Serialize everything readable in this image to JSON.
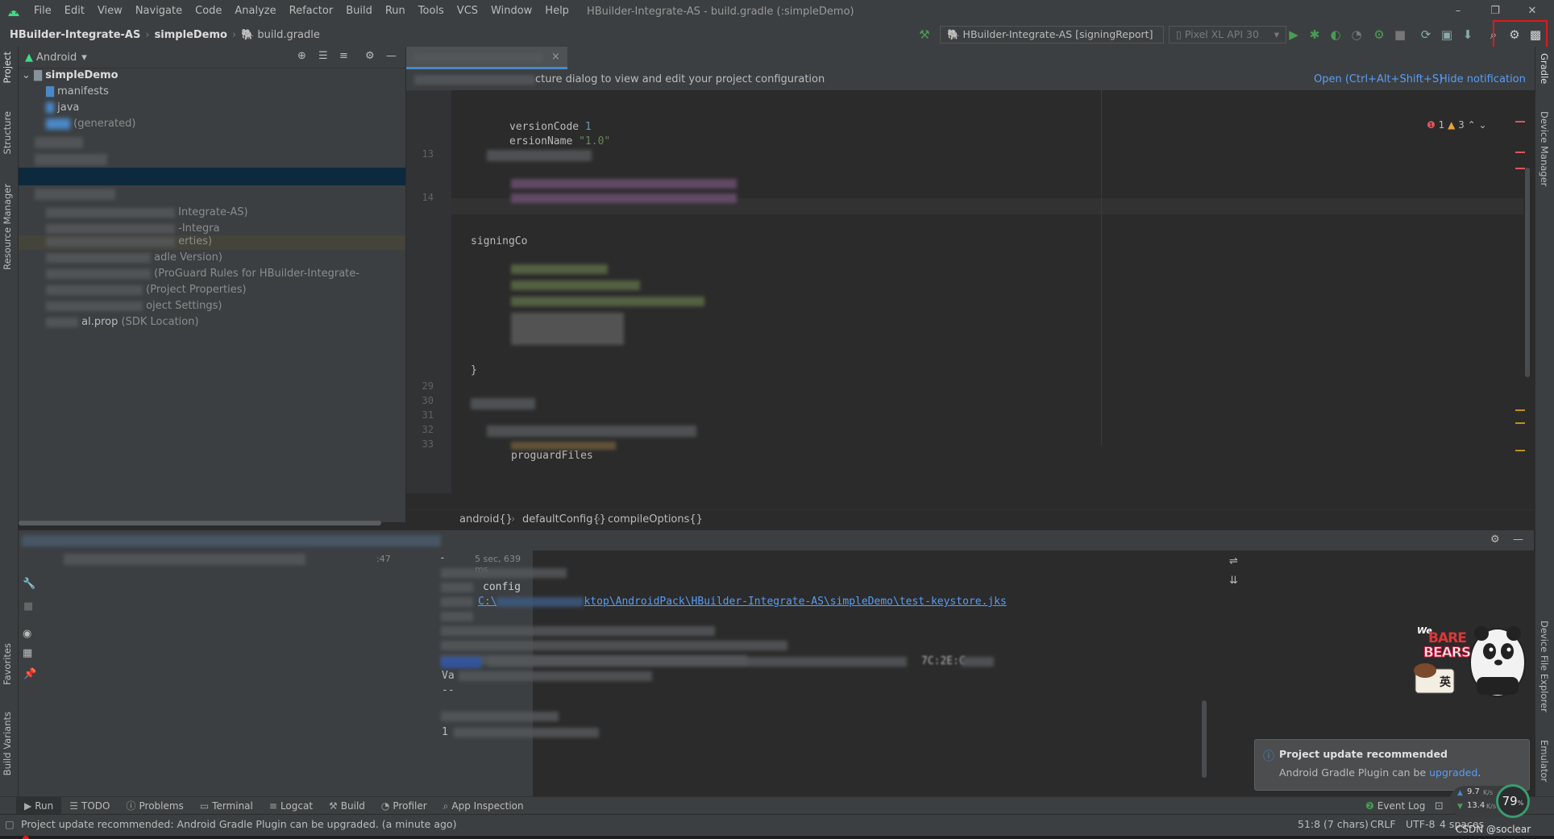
{
  "menu": [
    "File",
    "Edit",
    "View",
    "Navigate",
    "Code",
    "Analyze",
    "Refactor",
    "Build",
    "Run",
    "Tools",
    "VCS",
    "Window",
    "Help"
  ],
  "window_title": "HBuilder-Integrate-AS - build.gradle (:simpleDemo)",
  "breadcrumb": [
    "HBuilder-Integrate-AS",
    "simpleDemo",
    "build.gradle"
  ],
  "run_config": "HBuilder-Integrate-AS [signingReport]",
  "device": "Pixel XL API 30",
  "left_tabs": [
    "Project",
    "Structure",
    "Resource Manager",
    "Favorites",
    "Build Variants"
  ],
  "right_tabs": [
    "Gradle",
    "Device Manager",
    "Device File Explorer",
    "Emulator"
  ],
  "project": {
    "view_selector": "Android",
    "root": "simpleDemo",
    "items": [
      "manifests",
      "java",
      "(generated)",
      "Integrate-AS)",
      "-Integra",
      "erties)",
      "adle Version)",
      "(ProGuard Rules for HBuilder-Integrate-",
      "(Project Properties)",
      "oject Settings)",
      "(SDK Location)",
      "al.prop"
    ]
  },
  "notification": {
    "text": "cture dialog to view and edit your project configuration",
    "open_link": "Open (Ctrl+Alt+Shift+S)",
    "hide_link": "Hide notification"
  },
  "inspections": {
    "errors": "1",
    "warnings": "3"
  },
  "code": {
    "line_numbers": [
      "13",
      "14",
      "29",
      "30",
      "31",
      "32",
      "33"
    ],
    "version_code_key": "versionCode",
    "version_code_val": "1",
    "version_name_key": "ersionName",
    "version_name_val": "\"1.0\"",
    "signing": "signingCo",
    "brace": "}",
    "proguard": "proguardFiles"
  },
  "editor_breadcrumb": [
    "android{}",
    "defaultConfig{}",
    "compileOptions{}"
  ],
  "run": {
    "time_left": ":47",
    "duration": "5 sec, 639 ms",
    "dash": "-",
    "config": "config",
    "keystore_path": "C:\\",
    "keystore_path_rest": "ktop\\AndroidPack\\HBuilder-Integrate-AS\\simpleDemo\\test-keystore.jks",
    "va": "Va",
    "dashes": "--",
    "one": "1",
    "sha_tail": "7C:2E:C"
  },
  "tool_tabs": [
    "Run",
    "TODO",
    "Problems",
    "Terminal",
    "Logcat",
    "Build",
    "Profiler",
    "App Inspection"
  ],
  "event_log": "Event Log",
  "status": {
    "message": "Project update recommended: Android Gradle Plugin can be upgraded. (a minute ago)",
    "position": "51:8 (7 chars)",
    "line_sep": "CRLF",
    "encoding": "UTF-8",
    "indent": "4 spaces",
    "watermark": "CSDN @soclear"
  },
  "popup": {
    "title": "Project update recommended",
    "body": "Android Gradle Plugin can be ",
    "link": "upgraded",
    "period": "."
  },
  "net": {
    "up": "9.7",
    "down": "13.4",
    "unit": "K/s",
    "percent": "79",
    "percent_unit": "%"
  },
  "sticker": {
    "top": "We",
    "bare": "BARE",
    "bears": "BEARS",
    "glyph": "英"
  },
  "colors": {
    "accent": "#589df6",
    "highlight": "#e0191b",
    "run": "#499c54"
  }
}
